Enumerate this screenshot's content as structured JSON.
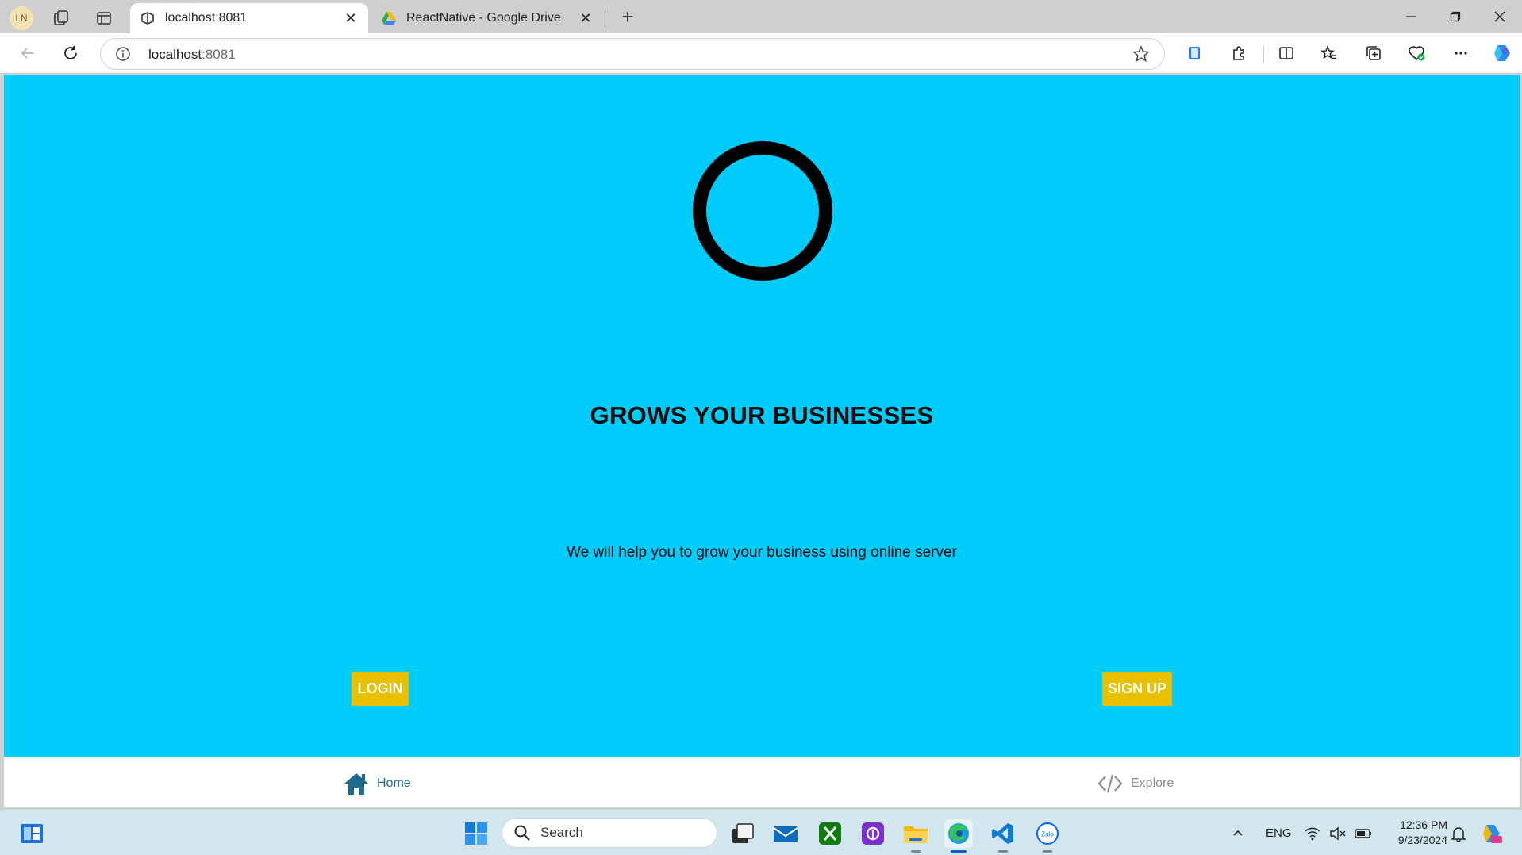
{
  "browser": {
    "profile_initials": "LN",
    "tabs": [
      {
        "label": "localhost:8081",
        "active": true
      },
      {
        "label": "ReactNative - Google Drive",
        "active": false
      }
    ],
    "address": {
      "host": "localhost",
      "port": ":8081"
    }
  },
  "page": {
    "background_color": "#00ccf9",
    "headline": "GROWS YOUR BUSINESSES",
    "subline": "We will help you to grow your business using online server",
    "login_label": "LOGIN",
    "signup_label": "SIGN UP",
    "button_color": "#e8c000",
    "bottom_nav": [
      {
        "label": "Home",
        "icon": "home-icon",
        "active": true
      },
      {
        "label": "Explore",
        "icon": "code-icon",
        "active": false
      }
    ]
  },
  "taskbar": {
    "search_placeholder": "Search",
    "language": "ENG",
    "time": "12:36 PM",
    "date": "9/23/2024"
  }
}
